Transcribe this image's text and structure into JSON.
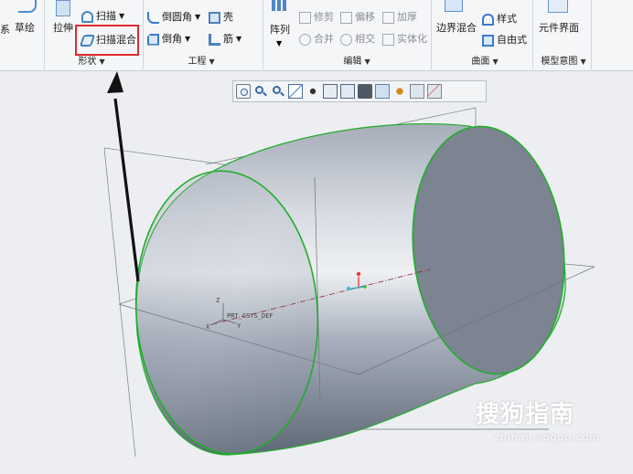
{
  "ribbon": {
    "left_partial": "系",
    "sketch": "草绘",
    "extrude": "拉伸",
    "sweep": "扫描",
    "swept_blend": "扫描混合",
    "shape_group": "形状",
    "round": "倒圆角",
    "chamfer": "倒角",
    "shell": "壳",
    "rib": "筋",
    "engineering_group": "工程",
    "pattern": "阵列",
    "trim": "修剪",
    "offset": "偏移",
    "thicken": "加厚",
    "merge": "合并",
    "intersect": "相交",
    "solidify": "实体化",
    "editing_group": "编辑",
    "boundary_blend": "边界混合",
    "style": "样式",
    "freestyle": "自由式",
    "surfaces_group": "曲面",
    "component_interface": "元件界面",
    "model_intent_group": "模型意图"
  },
  "viewport": {
    "csys_label": "PRT_CSYS_DEF",
    "axis_x": "X",
    "axis_y": "Y",
    "axis_z": "Z"
  },
  "view_toolbar": {
    "icons": [
      "refit-icon",
      "zoom-in-icon",
      "zoom-out-icon",
      "repaint-icon",
      "spin-center-icon",
      "view-manager-icon",
      "named-views-icon",
      "display-style-icon",
      "datum-display-icon",
      "annotation-display-icon",
      "appearance-icon",
      "csys-display-icon"
    ]
  },
  "watermark": {
    "brand": "搜狗指南",
    "url": "zhinan.sogou.com"
  },
  "colors": {
    "highlight_box": "#e02b2b",
    "edge_green": "#1fae2a",
    "body_gray": "#9aa3b1"
  }
}
